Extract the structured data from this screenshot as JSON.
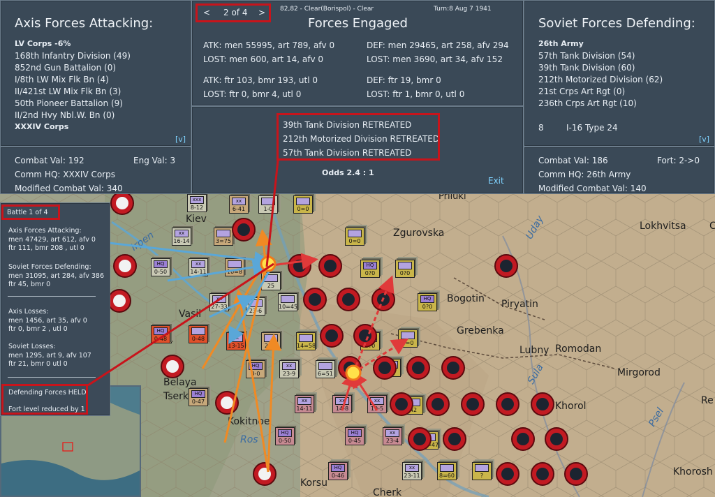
{
  "header": {
    "axis_title": "Axis Forces Attacking:",
    "soviet_title": "Soviet Forces Defending:",
    "engaged_title": "Forces Engaged",
    "nav_prev": "<",
    "nav_next": ">",
    "nav_page": "2 of 4",
    "hex_info": "82,82 - Clear(Borispol) - Clear",
    "turn_info": "Turn:8  Aug 7 1941"
  },
  "axis": {
    "units": [
      {
        "label": "LV Corps  -6%",
        "bold": true
      },
      {
        "label": "168th Infantry Division (49)"
      },
      {
        "label": "852nd Gun Battalion (0)"
      },
      {
        "label": "I/8th LW Mix Flk Bn (4)"
      },
      {
        "label": "II/421st LW Mix Flk Bn (3)"
      },
      {
        "label": "50th Pioneer Battalion (9)"
      },
      {
        "label": "II/2nd Hvy Nbl.W. Bn (0)"
      },
      {
        "label": "XXXIV Corps",
        "bold": true
      }
    ],
    "expand": "[v]",
    "combat_val": "Combat Val: 192",
    "eng_val": "Eng Val: 3",
    "comm_hq": "Comm HQ: XXXIV Corps",
    "modified": "Modified Combat Val: 340"
  },
  "soviet": {
    "units": [
      {
        "label": "26th Army",
        "bold": true
      },
      {
        "label": "57th Tank Division (54)"
      },
      {
        "label": "39th Tank Division (60)"
      },
      {
        "label": "212th Motorized Division (62)"
      },
      {
        "label": "21st Crps Art Rgt (0)"
      },
      {
        "label": "236th Crps Art Rgt (10)"
      }
    ],
    "air_count": "8",
    "air_type": "I-16 Type 24",
    "expand": "[v]",
    "combat_val": "Combat Val: 186",
    "fort": "Fort: 2->0",
    "comm_hq": "Comm HQ: 26th Army",
    "modified": "Modified Combat Val: 140"
  },
  "engaged": {
    "atk_ground": "ATK: men 55995, art 789, afv 0",
    "atk_lost": "LOST: men 600, art 14, afv 0",
    "def_ground": "DEF: men 29465, art 258, afv 294",
    "def_lost": "LOST: men 3690, art 34, afv 152",
    "atk_air": "ATK: ftr 103, bmr 193, utl 0",
    "atk_air_lost": "LOST: ftr 0, bmr 4, utl 0",
    "def_air": "DEF: ftr 19, bmr 0",
    "def_air_lost": "LOST: ftr 1, bmr 0, utl 0",
    "results": [
      "39th Tank Division RETREATED",
      "212th Motorized Division RETREATED",
      "57th Tank Division RETREATED"
    ],
    "odds": "Odds 2.4 : 1",
    "exit": "Exit"
  },
  "battle_panel": {
    "title": "Battle  1  of 4",
    "axis_head": "Axis Forces Attacking:",
    "axis_l1": "men 47429, art 612, afv 0",
    "axis_l2": "ftr 111, bmr 208 , utl 0",
    "sov_head": "Soviet Forces Defending:",
    "sov_l1": "men 31095, art 284, afv 386",
    "sov_l2": "ftr 45, bmr 0",
    "axl_head": "Axis Losses:",
    "axl_l1": "men 1456, art 35, afv 0",
    "axl_l2": "ftr 0, bmr 2 , utl 0",
    "sovl_head": "Soviet Losses:",
    "sovl_l1": "men 1295, art 9, afv 107",
    "sovl_l2": "ftr 21, bmr 0  utl 0",
    "result": "Defending Forces HELD",
    "fort": "Fort level reduced by 1"
  },
  "map": {
    "towns": [
      "Zgurovska",
      "Lokhvitsa",
      "Piryatin",
      "Grebenka",
      "Lubny",
      "Romodan",
      "Mirgorod",
      "Khorol",
      "Kokitnoe",
      "Tserk",
      "Belaya",
      "Vasil",
      "Kiev",
      "Priluki",
      "Bogotin",
      "Korsu",
      "Khorosh",
      "Cherk",
      "Re",
      "C"
    ],
    "rivers": [
      "Irpen",
      "Uday",
      "Sula",
      "Psel",
      "Ros"
    ],
    "counters": [
      {
        "top": "xxx",
        "bottom": "8-12"
      },
      {
        "top": "xx",
        "bottom": "6-41"
      },
      {
        "top": "",
        "bottom": "1-0"
      },
      {
        "top": "",
        "bottom": "0=0"
      },
      {
        "top": "xx",
        "bottom": "16-14"
      },
      {
        "top": "",
        "bottom": "3=75"
      },
      {
        "top": "",
        "bottom": "0=0"
      },
      {
        "top": "HQ",
        "bottom": "0-50"
      },
      {
        "top": "xx",
        "bottom": "14-11"
      },
      {
        "top": "",
        "bottom": "10=8"
      },
      {
        "top": "",
        "bottom": "25"
      },
      {
        "top": "HQ",
        "bottom": "0?0"
      },
      {
        "top": "",
        "bottom": "0?0"
      },
      {
        "top": "HQ",
        "bottom": "0?0"
      },
      {
        "top": "xx",
        "bottom": "27-33"
      },
      {
        "top": "",
        "bottom": "23-6"
      },
      {
        "top": "",
        "bottom": "10=45"
      },
      {
        "top": "",
        "bottom": "0-50"
      },
      {
        "top": "",
        "bottom": "0-48"
      },
      {
        "top": "HQ",
        "bottom": "0-48"
      },
      {
        "top": "xx",
        "bottom": "13-15"
      },
      {
        "top": "",
        "bottom": "22-6"
      },
      {
        "top": "",
        "bottom": "14=58"
      },
      {
        "top": "",
        "bottom": "0?0"
      },
      {
        "top": "",
        "bottom": "0=0"
      },
      {
        "top": "HQ",
        "bottom": "0-0"
      },
      {
        "top": "xx",
        "bottom": "23-9"
      },
      {
        "top": "",
        "bottom": "6=51"
      },
      {
        "top": "",
        "bottom": "37"
      },
      {
        "top": "HQ",
        "bottom": "0-47"
      },
      {
        "top": "xx",
        "bottom": "14-11"
      },
      {
        "top": "xx",
        "bottom": "14-8"
      },
      {
        "top": "xx",
        "bottom": "19-5"
      },
      {
        "top": "",
        "bottom": "42"
      },
      {
        "top": "HQ",
        "bottom": "0-50"
      },
      {
        "top": "HQ",
        "bottom": "0-45"
      },
      {
        "top": "xx",
        "bottom": "23-4"
      },
      {
        "top": "",
        "bottom": "11=47"
      },
      {
        "top": "HQ",
        "bottom": "0-46"
      },
      {
        "top": "xx",
        "bottom": "23-11"
      },
      {
        "top": "",
        "bottom": "8=60"
      },
      {
        "top": "",
        "bottom": "?"
      }
    ]
  },
  "colors": {
    "panel": "#3a4957",
    "highlight": "#c8141b",
    "soviet_red": "#c21a22",
    "axis_gray": "#c9c9b4",
    "arrow_orange": "#f08a24",
    "arrow_blue": "#5aa7d8",
    "arrow_red": "#e03a3a"
  }
}
